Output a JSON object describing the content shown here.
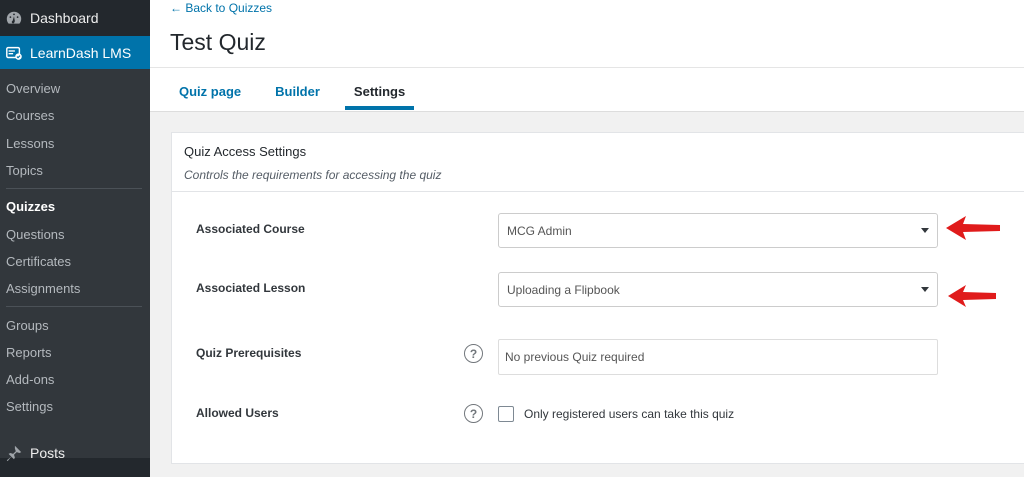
{
  "sidebar": {
    "dashboard": {
      "label": "Dashboard",
      "icon": "dashboard-icon"
    },
    "learndash": {
      "label": "LearnDash LMS",
      "icon": "learndash-icon"
    },
    "items": [
      {
        "label": "Overview"
      },
      {
        "label": "Courses"
      },
      {
        "label": "Lessons"
      },
      {
        "label": "Topics"
      },
      {
        "label": "Quizzes"
      },
      {
        "label": "Questions"
      },
      {
        "label": "Certificates"
      },
      {
        "label": "Assignments"
      },
      {
        "label": "Groups"
      },
      {
        "label": "Reports"
      },
      {
        "label": "Add-ons"
      },
      {
        "label": "Settings"
      }
    ],
    "posts": {
      "label": "Posts",
      "icon": "pushpin-icon"
    }
  },
  "header": {
    "back_link": "← Back to Quizzes",
    "title": "Test Quiz",
    "tabs": [
      {
        "label": "Quiz page"
      },
      {
        "label": "Builder"
      },
      {
        "label": "Settings"
      }
    ],
    "active_tab": "Settings"
  },
  "panel": {
    "title": "Quiz Access Settings",
    "description": "Controls the requirements for accessing the quiz",
    "fields": {
      "course": {
        "label": "Associated Course",
        "value": "MCG Admin"
      },
      "lesson": {
        "label": "Associated Lesson",
        "value": "Uploading a Flipbook"
      },
      "prereq": {
        "label": "Quiz Prerequisites",
        "placeholder": "No previous Quiz required",
        "help": "?"
      },
      "allowed": {
        "label": "Allowed Users",
        "checkbox_label": "Only registered users can take this quiz",
        "help": "?",
        "checked": false
      }
    }
  },
  "colors": {
    "accent": "#0073aa",
    "sidebar_bg": "#23282d",
    "submenu_bg": "#32373c",
    "annotation_arrow": "#e01b1b"
  }
}
